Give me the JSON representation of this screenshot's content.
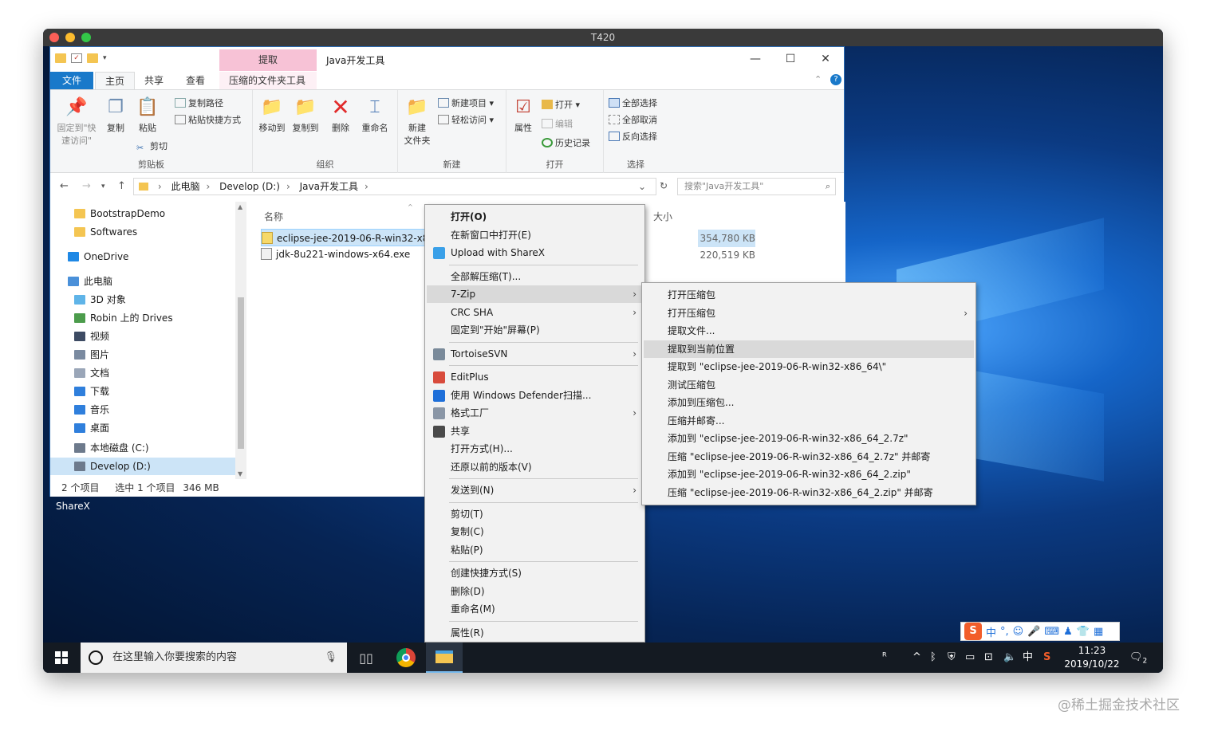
{
  "vm_title": "T420",
  "explorer": {
    "title": "Java开发工具",
    "context_tab": "提取",
    "tabs": [
      "文件",
      "主页",
      "共享",
      "查看",
      "压缩的文件夹工具"
    ],
    "ribbon": {
      "clipboard": {
        "pin": "固定到\"快\n速访问\"",
        "copy": "复制",
        "paste": "粘贴",
        "copy_path": "复制路径",
        "paste_shortcut": "粘贴快捷方式",
        "cut": "剪切",
        "label": "剪贴板"
      },
      "organize": {
        "move_to": "移动到",
        "copy_to": "复制到",
        "delete": "删除",
        "rename": "重命名",
        "label": "组织"
      },
      "new": {
        "new_folder": "新建\n文件夹",
        "new_item": "新建项目",
        "easy_access": "轻松访问",
        "label": "新建"
      },
      "open": {
        "properties": "属性",
        "open": "打开",
        "edit": "编辑",
        "history": "历史记录",
        "label": "打开"
      },
      "select": {
        "select_all": "全部选择",
        "select_none": "全部取消",
        "invert": "反向选择",
        "label": "选择"
      }
    },
    "address": [
      "此电脑",
      "Develop (D:)",
      "Java开发工具"
    ],
    "search_placeholder": "搜索\"Java开发工具\"",
    "nav_items": [
      {
        "label": "BootstrapDemo",
        "icon": "folder-icon",
        "color": "#f4c552"
      },
      {
        "label": "Softwares",
        "icon": "folder-icon",
        "color": "#f4c552"
      },
      {
        "label": "OneDrive",
        "icon": "cloud-icon",
        "color": "#1e88e5"
      },
      {
        "label": "此电脑",
        "icon": "computer-icon",
        "color": "#4a90d9"
      },
      {
        "label": "3D 对象",
        "icon": "cube-icon",
        "color": "#5fb4e8"
      },
      {
        "label": "Robin 上的 Drives",
        "icon": "network-drive-icon",
        "color": "#4c9c4c"
      },
      {
        "label": "视频",
        "icon": "video-icon",
        "color": "#3d4b63"
      },
      {
        "label": "图片",
        "icon": "picture-icon",
        "color": "#7a8aa0"
      },
      {
        "label": "文档",
        "icon": "document-icon",
        "color": "#9aa6b8"
      },
      {
        "label": "下载",
        "icon": "download-icon",
        "color": "#2f7fdc"
      },
      {
        "label": "音乐",
        "icon": "music-icon",
        "color": "#2f7fdc"
      },
      {
        "label": "桌面",
        "icon": "desktop-icon",
        "color": "#2f7fdc"
      },
      {
        "label": "本地磁盘 (C:)",
        "icon": "drive-icon",
        "color": "#6d7a8c"
      },
      {
        "label": "Develop (D:)",
        "icon": "drive-icon",
        "color": "#6d7a8c"
      }
    ],
    "columns": {
      "name": "名称",
      "size": "大小"
    },
    "files": [
      {
        "name": "eclipse-jee-2019-06-R-win32-x86",
        "size": "354,780 KB",
        "selected": true
      },
      {
        "name": "jdk-8u221-windows-x64.exe",
        "size": "220,519 KB",
        "selected": false
      }
    ],
    "status": {
      "count": "2 个项目",
      "selected": "选中 1 个项目",
      "size": "346 MB"
    }
  },
  "sharex_label": "ShareX",
  "context_menu": [
    {
      "label": "打开(O)",
      "bold": true
    },
    {
      "label": "在新窗口中打开(E)"
    },
    {
      "label": "Upload with ShareX",
      "icon": "sharex-icon"
    },
    {
      "sep": true
    },
    {
      "label": "全部解压缩(T)..."
    },
    {
      "label": "7-Zip",
      "submenu": true,
      "highlight": true
    },
    {
      "label": "CRC SHA",
      "submenu": true
    },
    {
      "label": "固定到\"开始\"屏幕(P)"
    },
    {
      "sep": true
    },
    {
      "label": "TortoiseSVN",
      "icon": "tortoisesvn-icon",
      "submenu": true
    },
    {
      "sep": true
    },
    {
      "label": "EditPlus",
      "icon": "editplus-icon"
    },
    {
      "label": "使用 Windows Defender扫描...",
      "icon": "defender-icon"
    },
    {
      "label": "格式工厂",
      "icon": "format-factory-icon",
      "submenu": true
    },
    {
      "label": "共享",
      "icon": "share-icon"
    },
    {
      "label": "打开方式(H)..."
    },
    {
      "label": "还原以前的版本(V)"
    },
    {
      "sep": true
    },
    {
      "label": "发送到(N)",
      "submenu": true
    },
    {
      "sep": true
    },
    {
      "label": "剪切(T)"
    },
    {
      "label": "复制(C)"
    },
    {
      "label": "粘贴(P)"
    },
    {
      "sep": true
    },
    {
      "label": "创建快捷方式(S)"
    },
    {
      "label": "删除(D)"
    },
    {
      "label": "重命名(M)"
    },
    {
      "sep": true
    },
    {
      "label": "属性(R)"
    }
  ],
  "zip_menu": [
    {
      "label": "打开压缩包"
    },
    {
      "label": "打开压缩包",
      "submenu": true
    },
    {
      "label": "提取文件..."
    },
    {
      "label": "提取到当前位置",
      "highlight": true
    },
    {
      "label": "提取到 \"eclipse-jee-2019-06-R-win32-x86_64\\\""
    },
    {
      "label": "测试压缩包"
    },
    {
      "label": "添加到压缩包..."
    },
    {
      "label": "压缩并邮寄..."
    },
    {
      "label": "添加到 \"eclipse-jee-2019-06-R-win32-x86_64_2.7z\""
    },
    {
      "label": "压缩 \"eclipse-jee-2019-06-R-win32-x86_64_2.7z\" 并邮寄"
    },
    {
      "label": "添加到 \"eclipse-jee-2019-06-R-win32-x86_64_2.zip\""
    },
    {
      "label": "压缩 \"eclipse-jee-2019-06-R-win32-x86_64_2.zip\" 并邮寄"
    }
  ],
  "taskbar": {
    "search_placeholder": "在这里输入你要搜索的内容",
    "time": "11:23",
    "date": "2019/10/22",
    "ime": "中",
    "notification_count": "2"
  },
  "sogou": {
    "logo": "S",
    "mode": "中"
  },
  "watermark": "@稀土掘金技术社区"
}
